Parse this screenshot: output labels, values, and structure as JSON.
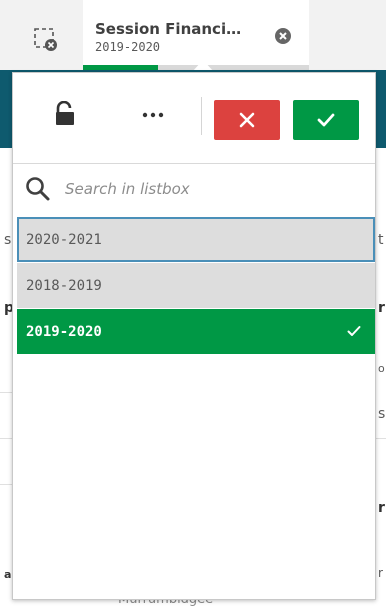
{
  "selection_bar": {
    "chip": {
      "title": "Session Financi…",
      "value": "2019-2020",
      "selected_fraction": 0.33
    }
  },
  "background": {
    "fragments": [
      "s",
      "p",
      "t",
      "r",
      "o",
      "s",
      "r",
      "a",
      "r"
    ],
    "bottom_text": "Murrumbidgee"
  },
  "listbox": {
    "search": {
      "placeholder": "Search in listbox",
      "value": ""
    },
    "items": [
      {
        "label": "2020-2021",
        "state": "alternative",
        "focused": true
      },
      {
        "label": "2018-2019",
        "state": "alternative",
        "focused": false
      },
      {
        "label": "2019-2020",
        "state": "selected",
        "focused": false
      }
    ]
  },
  "colors": {
    "selected_green": "#009845",
    "cancel_red": "#dc423f",
    "alternative_grey": "#dddddd",
    "header_teal": "#0e5a6e"
  }
}
